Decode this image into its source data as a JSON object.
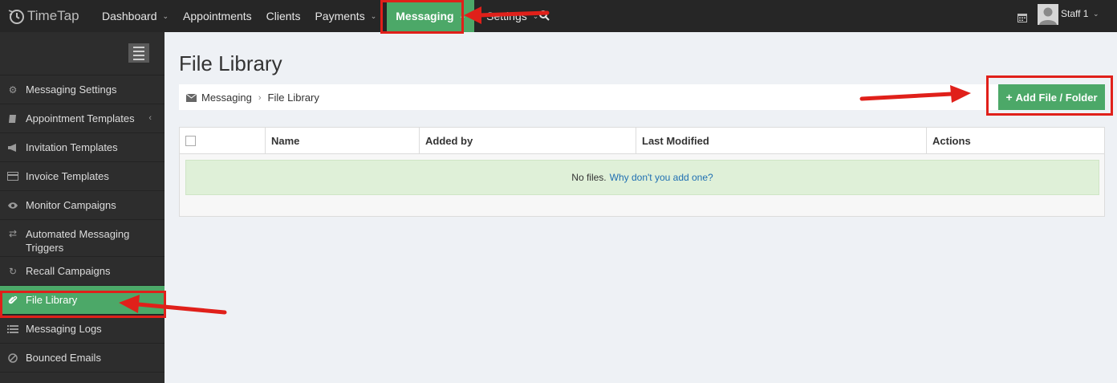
{
  "app": {
    "logo_text": "TimeTap"
  },
  "nav": {
    "items": [
      {
        "label": "Dashboard",
        "has_menu": true
      },
      {
        "label": "Appointments",
        "has_menu": false
      },
      {
        "label": "Clients",
        "has_menu": false
      },
      {
        "label": "Payments",
        "has_menu": true
      },
      {
        "label": "Messaging",
        "has_menu": true,
        "active": true
      },
      {
        "label": "Settings",
        "has_menu": true
      }
    ],
    "user_label": "Staff 1"
  },
  "sidebar": {
    "items": [
      {
        "label": "Messaging Settings",
        "icon": "gears-icon"
      },
      {
        "label": "Appointment Templates",
        "icon": "book-icon",
        "has_submenu": true
      },
      {
        "label": "Invitation Templates",
        "icon": "bullhorn-icon"
      },
      {
        "label": "Invoice Templates",
        "icon": "credit-card-icon"
      },
      {
        "label": "Monitor Campaigns",
        "icon": "eye-icon"
      },
      {
        "label": "Automated Messaging Triggers",
        "icon": "random-icon"
      },
      {
        "label": "Recall Campaigns",
        "icon": "refresh-icon"
      },
      {
        "label": "File Library",
        "icon": "paperclip-icon",
        "active": true
      },
      {
        "label": "Messaging Logs",
        "icon": "list-icon"
      },
      {
        "label": "Bounced Emails",
        "icon": "ban-icon"
      }
    ]
  },
  "page": {
    "title": "File Library",
    "breadcrumb": [
      "Messaging",
      "File Library"
    ],
    "add_button_label": "Add File / Folder",
    "table": {
      "columns": [
        "Name",
        "Added by",
        "Last Modified",
        "Actions"
      ],
      "empty_text": "No files.",
      "empty_link": "Why don't you add one?"
    }
  },
  "colors": {
    "accent_green": "#4ca868",
    "nav_bg": "#262626",
    "sidebar_bg": "#2d2d2d",
    "annotation_red": "#e0201a",
    "link_blue": "#1f6fb2"
  }
}
